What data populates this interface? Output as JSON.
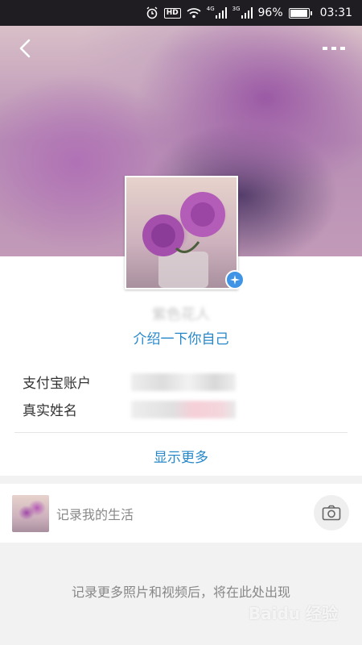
{
  "status_bar": {
    "alarm_icon": "alarm-clock-icon",
    "hd": "HD",
    "wifi_icon": "wifi-icon",
    "net1": "4G",
    "net2": "3G",
    "battery_pct": "96%",
    "time": "03:31"
  },
  "header": {
    "back_icon": "chevron-left-icon",
    "more_icon": "more-dots-icon"
  },
  "profile": {
    "nickname": "紫色花人",
    "intro_link": "介绍一下你自己",
    "fields": [
      {
        "label": "支付宝账户",
        "value": ""
      },
      {
        "label": "真实姓名",
        "value": ""
      }
    ],
    "show_more": "显示更多"
  },
  "life": {
    "text": "记录我的生活",
    "camera_icon": "camera-icon"
  },
  "empty_hint": "记录更多照片和视频后，将在此处出现",
  "watermark": "Baidu 经验",
  "colors": {
    "link": "#2788c9",
    "verified": "#3f94e6",
    "status_bar": "#1f1d22"
  }
}
